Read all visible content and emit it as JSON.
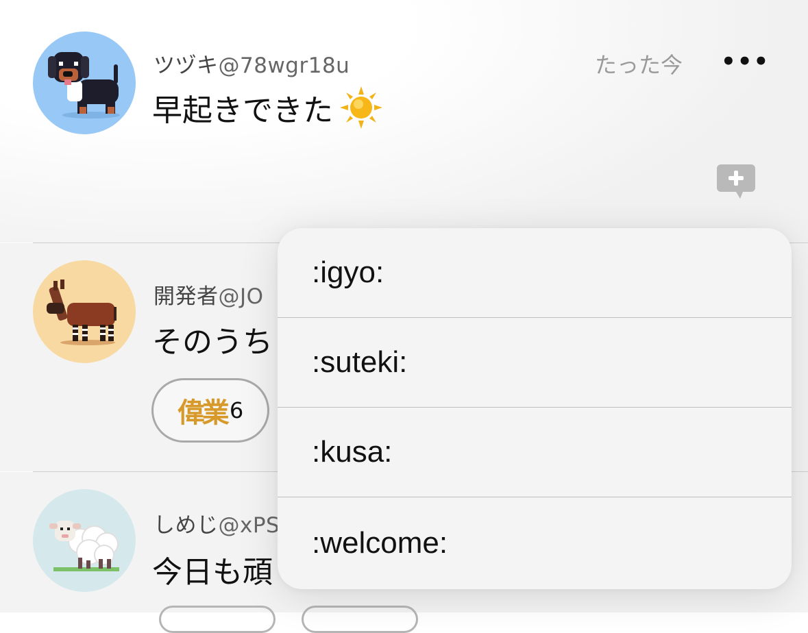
{
  "posts": [
    {
      "display_name": "ツヅキ",
      "handle": "@78wgr18u",
      "time": "たった今",
      "text": "早起きできた",
      "avatar": "dachshund-pixel-avatar",
      "avatar_bg": "#97c8f6",
      "text_emoji": "sun-emoji",
      "more_label": "•••"
    },
    {
      "display_name": "開発者",
      "handle": "@JO",
      "text": "そのうち",
      "avatar": "okapi-pixel-avatar",
      "avatar_bg": "#f7d9a1",
      "reactions": [
        {
          "emoji_text": "偉業",
          "count": "6"
        }
      ]
    },
    {
      "display_name": "しめじ",
      "handle": "@xPS",
      "text": "今日も頑",
      "avatar": "sheep-pixel-avatar",
      "avatar_bg": "#d5e9ec"
    }
  ],
  "reaction_menu": {
    "items": [
      ":igyo:",
      ":suteki:",
      ":kusa:",
      ":welcome:"
    ]
  },
  "colors": {
    "reaction_chip_emoji": "#d79a2a",
    "time": "#9a9a9a",
    "reaction_add_icon": "#b9b9b9"
  }
}
